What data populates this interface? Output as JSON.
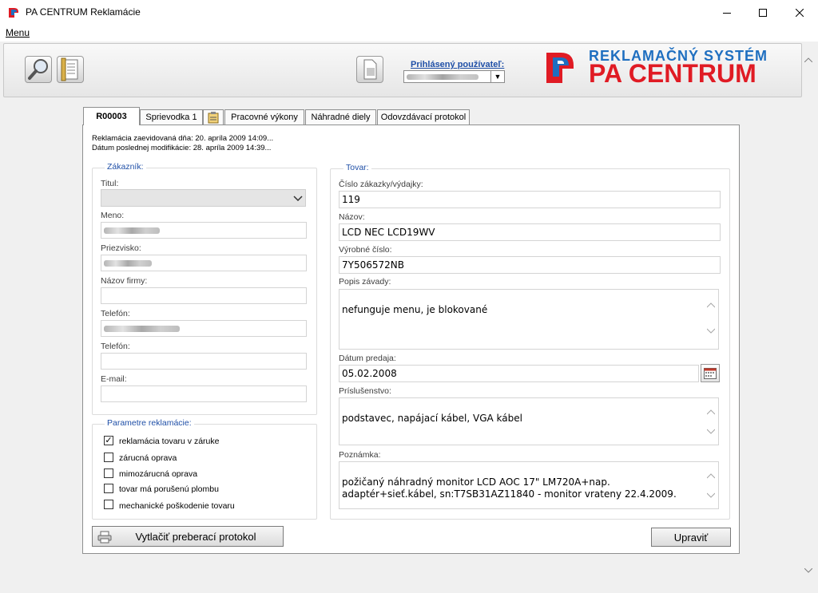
{
  "window": {
    "title": "PA CENTRUM Reklamácie",
    "minimize_icon": "minimize-icon",
    "maximize_icon": "maximize-icon",
    "close_icon": "close-icon"
  },
  "menubar": {
    "menu_label": "Menu"
  },
  "header": {
    "logged_user_label": "Prihlásený používateľ:",
    "logged_user_value": "",
    "logo_line1": "REKLAMAČNÝ SYSTÉM",
    "logo_line2": "PA CENTRUM",
    "colors": {
      "brand_blue": "#1f6fc0",
      "brand_red": "#e01b24"
    }
  },
  "tabs": [
    {
      "label": "R00003",
      "active": true
    },
    {
      "label": "Sprievodka 1",
      "active": false
    },
    {
      "label": "",
      "icon": "clipboard-icon",
      "active": false
    },
    {
      "label": "Pracovné výkony",
      "active": false
    },
    {
      "label": "Náhradné diely",
      "active": false
    },
    {
      "label": "Odovzdávací protokol",
      "active": false
    }
  ],
  "info": {
    "created": "Reklamácia zaevidovaná dňa: 20. apríla 2009 14:09...",
    "modified": "Dátum poslednej modifikácie: 28. apríla 2009 14:39..."
  },
  "customer": {
    "legend": "Zákazník:",
    "title_label": "Titul:",
    "title_value": "",
    "name_label": "Meno:",
    "name_value": "",
    "surname_label": "Priezvisko:",
    "surname_value": "",
    "company_label": "Názov firmy:",
    "company_value": "",
    "phone1_label": "Telefón:",
    "phone1_value": "",
    "phone2_label": "Telefón:",
    "phone2_value": "",
    "email_label": "E-mail:",
    "email_value": ""
  },
  "params": {
    "legend": "Parametre reklamácie:",
    "items": [
      {
        "label": "reklamácia tovaru v záruke",
        "checked": true
      },
      {
        "label": "zárucná oprava",
        "checked": false
      },
      {
        "label": "mimozárucná oprava",
        "checked": false
      },
      {
        "label": "tovar má porušenú plombu",
        "checked": false
      },
      {
        "label": "mechanické poškodenie tovaru",
        "checked": false
      }
    ]
  },
  "goods": {
    "legend": "Tovar:",
    "order_label": "Číslo zákazky/výdajky:",
    "order_value": "119",
    "name_label": "Názov:",
    "name_value": "LCD NEC LCD19WV",
    "serial_label": "Výrobné číslo:",
    "serial_value": "7Y506572NB",
    "defect_label": "Popis závady:",
    "defect_value": "nefunguje menu, je blokované",
    "sale_date_label": "Dátum predaja:",
    "sale_date_value": "05.02.2008",
    "accessories_label": "Príslušenstvo:",
    "accessories_value": "podstavec, napájací kábel, VGA kábel",
    "note_label": "Poznámka:",
    "note_value": "požičaný náhradný monitor LCD AOC 17\" LM720A+nap.\nadaptér+sieť.kábel, sn:T7SB31AZ11840 - monitor vrateny 22.4.2009."
  },
  "buttons": {
    "print_label": "Vytlačiť preberací protokol",
    "edit_label": "Upraviť"
  }
}
